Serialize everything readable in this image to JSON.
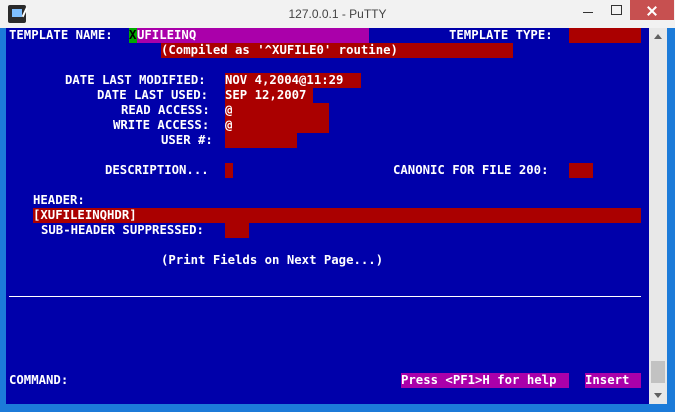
{
  "window": {
    "title": "127.0.0.1 - PuTTY",
    "colors": {
      "terminal_bg": "#0000aa",
      "field_red": "#aa0000",
      "field_magenta": "#aa00aa",
      "cursor": "#00aa00"
    }
  },
  "icons": {
    "app": "putty-icon",
    "minimize": "minimize-icon",
    "maximize": "maximize-icon",
    "close": "close-icon"
  },
  "screen": {
    "template_name_label": "TEMPLATE NAME:",
    "template_name_first": "X",
    "template_name_rest": "UFILEINQ",
    "template_type_label": "TEMPLATE TYPE:",
    "compiled_note": "(Compiled as '^XUFILE0' routine)",
    "date_last_modified_label": "DATE LAST MODIFIED:",
    "date_last_modified_value": "NOV 4,2004@11:29",
    "date_last_used_label": "DATE LAST USED:",
    "date_last_used_value": "SEP 12,2007",
    "read_access_label": "READ ACCESS:",
    "read_access_value": "@",
    "write_access_label": "WRITE ACCESS:",
    "write_access_value": "@",
    "user_num_label": "USER #:",
    "description_label": "DESCRIPTION...",
    "canonic_label": "CANONIC FOR FILE 200:",
    "header_label": "HEADER:",
    "header_value": "[XUFILEINQHDR]",
    "subheader_label": "SUB-HEADER SUPPRESSED:",
    "print_fields_note": "(Print Fields on Next Page...)",
    "command_label": "COMMAND:",
    "help_hint": "Press <PF1>H for help",
    "insert_mode": "Insert"
  }
}
